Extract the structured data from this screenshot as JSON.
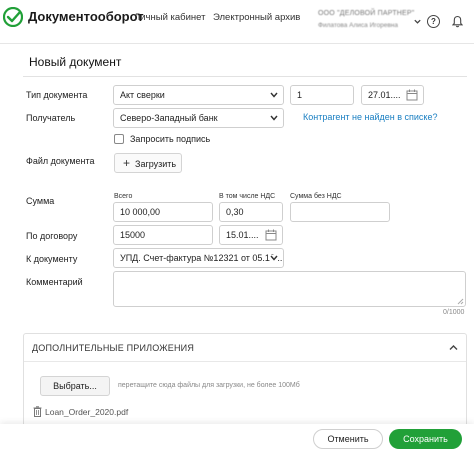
{
  "header": {
    "brand": "Документооборот",
    "nav": [
      "Личный кабинет",
      "Электронный архив"
    ],
    "org_name": "ООО \"ДЕЛОВОЙ ПАРТНЕР\"",
    "user_name": "Филатова Алиса Игоревна",
    "brand_color": "#21a038"
  },
  "form": {
    "title": "Новый документ",
    "doc_type": {
      "label": "Тип документа",
      "value": "Акт сверки",
      "number": "1",
      "date": "27.01...."
    },
    "recipient": {
      "label": "Получатель",
      "value": "Северо-Западный банк",
      "not_found_link": "Контрагент не найден в списке?"
    },
    "request_signature": {
      "label": "Запросить подпись",
      "checked": false
    },
    "file": {
      "label": "Файл документа",
      "upload_label": "Загрузить"
    },
    "amount": {
      "label": "Сумма",
      "total_label": "Всего",
      "total": "10 000,00",
      "vat_label": "В том числе НДС",
      "vat": "0,30",
      "no_vat_label": "Сумма без НДС",
      "no_vat": ""
    },
    "contract": {
      "label": "По договору",
      "value": "15000",
      "date": "15.01...."
    },
    "to_document": {
      "label": "К документу",
      "value": "УПД. Счет-фактура №12321 от 05.12...."
    },
    "comment": {
      "label": "Комментарий",
      "value": "",
      "counter": "0/1000"
    }
  },
  "attachments": {
    "title": "ДОПОЛНИТЕЛЬНЫЕ ПРИЛОЖЕНИЯ",
    "choose_label": "Выбрать...",
    "hint": "перетащите сюда файлы для загрузки, не более 100Мб",
    "files": [
      "Loan_Order_2020.pdf"
    ]
  },
  "footer": {
    "cancel_label": "Отменить",
    "save_label": "Сохранить"
  }
}
